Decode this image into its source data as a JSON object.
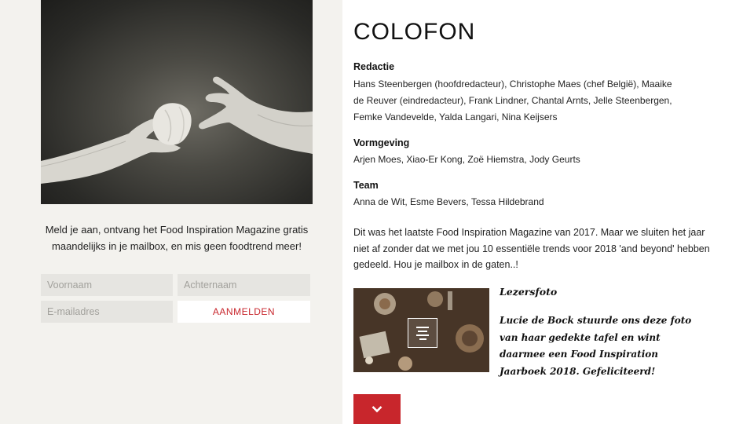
{
  "signup": {
    "text": "Meld je aan, ontvang het Food Inspiration Magazine gratis maandelijks in je mailbox, en mis geen foodtrend meer!",
    "first_name_placeholder": "Voornaam",
    "last_name_placeholder": "Achternaam",
    "email_placeholder": "E-mailadres",
    "submit_label": "AANMELDEN"
  },
  "colofon": {
    "title": "COLOFON",
    "sections": [
      {
        "heading": "Redactie",
        "body": "Hans Steenbergen (hoofdredacteur), Christophe Maes (chef België), Maaike de Reuver (eindredacteur), Frank Lindner, Chantal Arnts, Jelle Steenbergen, Femke Vandevelde, Yalda Langari, Nina Keijsers"
      },
      {
        "heading": "Vormgeving",
        "body": "Arjen Moes, Xiao-Er Kong, Zoë Hiemstra, Jody Geurts"
      },
      {
        "heading": "Team",
        "body": "Anna de Wit, Esme Bevers, Tessa Hildebrand"
      }
    ],
    "intro": "Dit was het laatste Food Inspiration Magazine van 2017. Maar we sluiten het jaar niet af zonder dat we met jou 10 essentiële trends voor 2018 'and beyond' hebben gedeeld. Hou je mailbox in de gaten..!"
  },
  "reader_photo": {
    "title": "Lezersfoto",
    "caption": "Lucie de Bock stuurde ons deze foto van haar gedekte tafel en wint daarmee een Food Inspiration Jaarboek 2018. Gefeliciteerd!"
  },
  "icons": {
    "gallery": "menu-lines-icon",
    "scroll": "chevron-down-icon"
  },
  "colors": {
    "accent": "#c8262c",
    "left_background": "#f3f2ee",
    "field_background": "#e6e5e1"
  }
}
